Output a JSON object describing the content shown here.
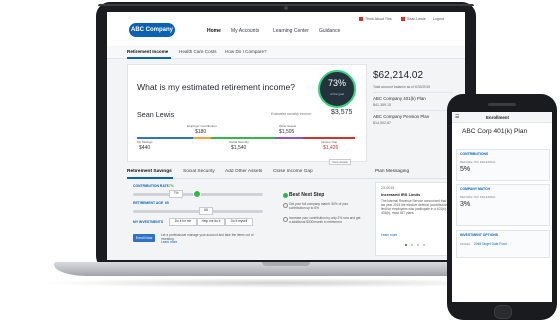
{
  "laptop": {
    "nav": {
      "logo": "ABC Company",
      "links": [
        "Home",
        "My Accounts",
        "Learning Center",
        "Guidance"
      ],
      "util_links": [
        "Think About This",
        "Sean Lewis",
        "Logout"
      ]
    },
    "subnav": [
      "Retirement Income",
      "Health Care Costs",
      "How Do I Compare?"
    ],
    "question": "What is my estimated retirement income?",
    "gauge": {
      "percent": "73%",
      "sublabel": "of the goal",
      "value": 73
    },
    "user_name": "Sean Lewis",
    "estimated_label": "Estimated monthly income:",
    "estimated_value": "$3,575",
    "top_sources": [
      {
        "label": "Employer Contribution",
        "value": "$180"
      },
      {
        "label": "Other Assets",
        "value": "$1,505"
      }
    ],
    "bottom_sources": [
      {
        "label": "My Savings",
        "value": "$440"
      },
      {
        "label": "Social Security",
        "value": "$1,540"
      },
      {
        "label": "Income Gap",
        "value": "$1,426"
      }
    ],
    "view_details": "View details",
    "balance": "$62,214.02",
    "balance_label": "Total account balance as of 6/30/2015",
    "plans": [
      {
        "name": "ABC Company 401(k) Plan",
        "value": "$41,389.15"
      },
      {
        "name": "ABC Company Pension Plan",
        "value": "$14,902.87"
      }
    ],
    "tabs": [
      "Retirement Savings",
      "Social Security",
      "Add Other Assets",
      "Close Income Gap"
    ],
    "plan_messaging": {
      "title": "Plan Messaging",
      "date": "2/1/2015",
      "heading": "Increased IRS Limits",
      "body": "The Internal Revenue Service announced that for tax year 2015 the elective deferral (contribution) limit for employees who participate in a 401(k), 403(b), most 457 plans",
      "link": "Learn more"
    },
    "contribution_rate_label": "CONTRIBUTION RATE",
    "contribution_rate_value": "7%",
    "retirement_age_label": "RETIREMENT AGE",
    "retirement_age_value": "65",
    "best_next_step": "Best Next Step",
    "tips": [
      "Get your full company match: 50% of your contribution up to 6%",
      "Increase your contribution by only 2% now and get a additional $300/month in retirement"
    ],
    "investments_label": "MY INVESTMENTS",
    "investment_options": [
      "Do it for me",
      "Help me do it",
      "Do it myself"
    ],
    "enroll_button": "Enroll Now",
    "help_text": "Let a professional manage your account and take the items out of investing.",
    "help_link": "Learn more"
  },
  "phone": {
    "header": "Enrollment",
    "title": "ABC Corp 401(k) Plan",
    "sections": [
      {
        "label": "CONTRIBUTIONS",
        "sub": "BEFORE-TAX DEFERRAL",
        "value": "5%"
      },
      {
        "label": "COMPANY MATCH",
        "sub": "BEFORE-TAX DEFERRAL",
        "value": "3%"
      },
      {
        "label": "INVESTMENT OPTIONS",
        "sub": "MODEL",
        "value": "2045 Target Date Fund"
      }
    ]
  },
  "colors": {
    "brand_blue": "#0b62b5",
    "green": "#35b64a",
    "red": "#d2332b",
    "orange": "#f0a53a",
    "gauge_bg": "#24323c"
  }
}
